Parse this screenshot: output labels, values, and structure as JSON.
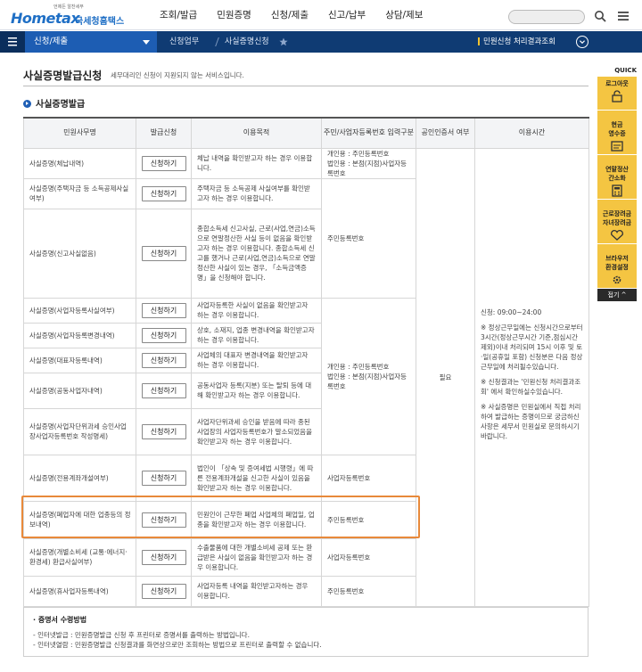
{
  "header": {
    "logo_small": "언제든 알찬세무",
    "logo_main": "Hometax",
    "logo_kor": "국세청홈택스",
    "gnb": [
      "조회/발급",
      "민원증명",
      "신청/제출",
      "신고/납부",
      "상담/제보"
    ]
  },
  "navbar": {
    "section": "신청/제출",
    "crumb1": "신청업무",
    "crumb2": "사실증명신청",
    "right": "민원신청 처리결과조회"
  },
  "quick": {
    "title": "QUICK",
    "items": [
      "로그아웃",
      "현금\n영수증",
      "연말정산\n간소화",
      "근로장려금\n자녀장려금",
      "브라우저\n환경설정"
    ],
    "top": "접기 ^"
  },
  "page": {
    "title": "사실증명발급신청",
    "note": "세무대리인 신청이 지원되지 않는 서비스입니다.",
    "section_title": "사실증명발급"
  },
  "table": {
    "headers": [
      "민원사무명",
      "발급신청",
      "이용목적",
      "주민/사업자등록번호 입력구분",
      "공인인증서 여부",
      "이용시간"
    ],
    "button_label": "신청하기",
    "rows": [
      {
        "name": "사실증명(체납내역)",
        "purpose": "체납 내역을 확인받고자 하는 경우 이용합니다."
      },
      {
        "name": "사실증명(주택자금 등 소득공제사실여부)",
        "purpose": "주택자금 등 소득공제 사실여부를 확인받고자 하는 경우 이용합니다."
      },
      {
        "name": "사실증명(신고사실없음)",
        "purpose": "종합소득세 신고사실, 근로(사업,연금)소득으로 연말정산한 사실 등이 없음을 확인받고자 하는 경우 이용합니다. 종합소득세 신고를 했거나 근로(사업,연금)소득으로 연말정산한 사실이 있는 경우, 「소득금액증명」을 신청해야 합니다."
      },
      {
        "name": "사실증명(사업자등록사실여부)",
        "purpose": "사업자등록한 사실이 없음을 확인받고자 하는 경우 이용합니다."
      },
      {
        "name": "사실증명(사업자등록변경내역)",
        "purpose": "상호, 소재지, 업종 변경내역을 확인받고자 하는 경우 이용합니다."
      },
      {
        "name": "사실증명(대표자등록내역)",
        "purpose": "사업체의 대표자 변경내역을 확인받고자 하는 경우 이용합니다."
      },
      {
        "name": "사실증명(공동사업자내역)",
        "purpose": "공동사업자 등록(지분) 또는 탈퇴 등에 대해 확인받고자 하는 경우 이용합니다."
      },
      {
        "name": "사실증명(사업자단위과세 승인사업장사업자등록번호 작성명세)",
        "purpose": "사업자단위과세 승인을 받음에 따라 종된 사업장의 사업자등록번호가 말소되었음을 확인받고자 하는 경우 이용합니다."
      },
      {
        "name": "사실증명(전용계좌개설여부)",
        "purpose": "법인이 「상속 및 증여세법 시행령」에 따른 전용계좌개설을 신고한 사실이 있음을 확인받고자 하는 경우 이용합니다."
      },
      {
        "name": "사실증명(폐업자에 대한 업종등의 정보내역)",
        "purpose": "민원인이 근무한 폐업 사업체의 폐업일, 업종을 확인받고자 하는 경우 이용합니다."
      },
      {
        "name": "사실증명(개별소비세 (교통·에너지·환경세) 환급사실여부)",
        "purpose": "수출물품에 대한 개별소비세 공제 또는 환급받은 사실이 없음을 확인받고자 하는 경우 이용합니다."
      },
      {
        "name": "사실증명(휴사업자등록내역)",
        "purpose": "사업자등록 내역을 확인받고자하는 경우 이용합니다."
      }
    ],
    "id_groups": [
      {
        "text": "개인용 : 주민등록번호\n법인용 : 본점(지점)사업자등록번호"
      },
      {
        "text": "주민등록번호"
      },
      {
        "text": "개인용 : 주민등록번호\n법인용 : 본점(지점)사업자등록번호"
      },
      {
        "text": "사업자등록번호"
      },
      {
        "text": "주민등록번호"
      },
      {
        "text": "사업자등록번호"
      },
      {
        "text": "주민등록번호"
      }
    ],
    "cert": "필요",
    "time": [
      "신청: 09:00~24:00",
      "※ 정상근무일에는 신청시간으로부터 3시간(정상근무시간 기준,점심시간 제외)이내 처리되며 15시 이후 및 토·일(공휴일 포함) 신청분은 다음 정상근무일에 처리될수있습니다.",
      "※ 신청결과는 '민원신청 처리결과조회' 에서 확인하실수있습니다.",
      "※ 사실증명은 민원실에서 직접 처리하여 발급하는 증명이므로 궁금하신 사항은 세무서 민원실로 문의하시기바랍니다."
    ]
  },
  "notice": {
    "title": "증명서 수령방법",
    "lines": [
      "- 인터넷발급 : 민원증명발급 신청 후 프린터로 증명서를 출력하는 방법입니다.",
      "- 인터넷열람 : 민원증명발급 신청결과를 화면상으로만 조회하는 방법으로 프린터로 출력할 수 없습니다."
    ]
  }
}
